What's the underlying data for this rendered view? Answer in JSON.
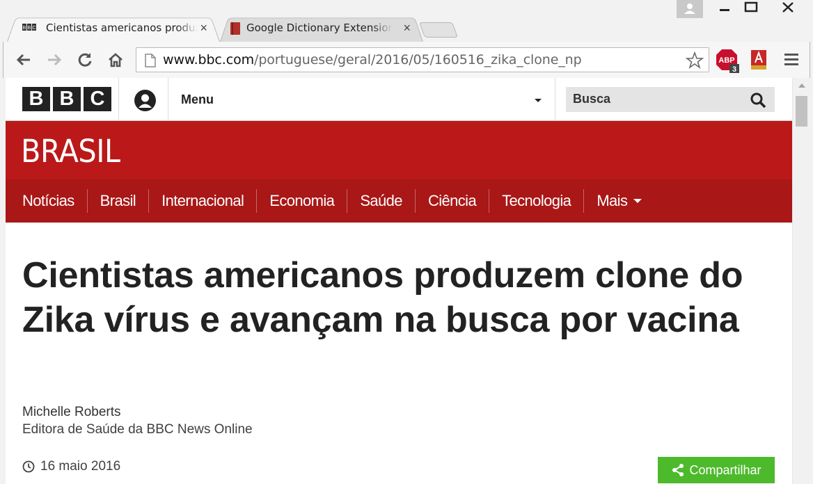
{
  "browser": {
    "tabs": [
      {
        "favicon": "bbc-favicon",
        "title": "Cientistas americanos produzem clone",
        "close": "×"
      },
      {
        "favicon": "dictionary-favicon",
        "title": "Google Dictionary Extension",
        "close": "×"
      }
    ],
    "url": {
      "host": "www.bbc.com",
      "path": "/portuguese/geral/2016/05/160516_zika_clone_np"
    },
    "extensions": [
      {
        "name": "adblock-plus-icon",
        "label": "ABP",
        "badge": "3"
      },
      {
        "name": "acrobat-icon"
      }
    ]
  },
  "site": {
    "logo_letters": [
      "B",
      "B",
      "C"
    ],
    "menu_label": "Menu",
    "search_placeholder": "Busca",
    "section_title": "BRASIL",
    "nav": [
      "Notícias",
      "Brasil",
      "Internacional",
      "Economia",
      "Saúde",
      "Ciência",
      "Tecnologia",
      "Mais"
    ]
  },
  "article": {
    "headline": "Cientistas americanos produzem clone do Zika vírus e avançam na busca por vacina",
    "author": "Michelle Roberts",
    "author_role": "Editora de Saúde da BBC News Online",
    "date": "16 maio 2016",
    "share_label": "Compartilhar"
  },
  "colors": {
    "bbc_red": "#bb1919",
    "nav_red": "#a91717",
    "share_green": "#4dba2c"
  }
}
